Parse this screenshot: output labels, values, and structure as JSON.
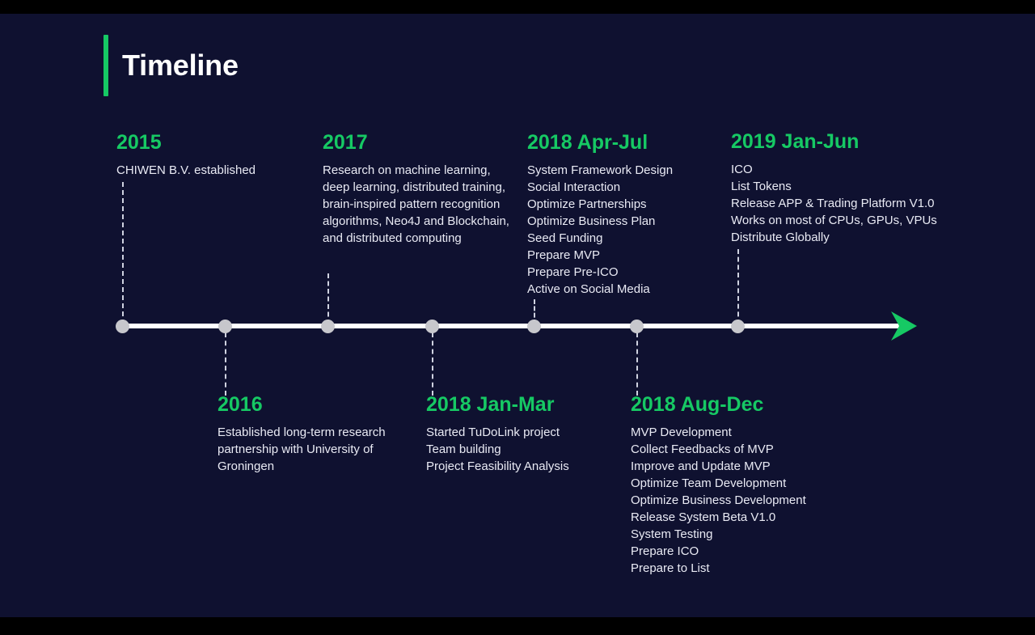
{
  "slide": {
    "title": "Timeline",
    "background_color": "#0f1130",
    "letterbox_color": "#000000",
    "accent_color": "#16c964",
    "text_color": "#e9eaf4",
    "axis_color": "#ffffff",
    "dot_color": "#c7c7cc"
  },
  "axis": {
    "arrow_icon": "arrow-right-icon",
    "node_count": 7
  },
  "entries": [
    {
      "id": "2015",
      "year": "2015",
      "position": "above",
      "lines": [
        "CHIWEN B.V. established"
      ]
    },
    {
      "id": "2016",
      "year": "2016",
      "position": "below",
      "lines": [
        "Established long-term research partnership with University of Groningen"
      ]
    },
    {
      "id": "2017",
      "year": "2017",
      "position": "above",
      "lines": [
        "Research on machine learning, deep learning, distributed training, brain-inspired pattern recognition algorithms, Neo4J and Blockchain, and distributed computing"
      ]
    },
    {
      "id": "2018-jan-mar",
      "year": "2018 Jan-Mar",
      "position": "below",
      "lines": [
        "Started TuDoLink project",
        "Team building",
        "Project Feasibility Analysis"
      ]
    },
    {
      "id": "2018-apr-jul",
      "year": "2018 Apr-Jul",
      "position": "above",
      "lines": [
        "System Framework Design",
        "Social Interaction",
        "Optimize Partnerships",
        "Optimize Business Plan",
        "Seed Funding",
        "Prepare MVP",
        "Prepare Pre-ICO",
        "Active on Social Media"
      ]
    },
    {
      "id": "2018-aug-dec",
      "year": "2018 Aug-Dec",
      "position": "below",
      "lines": [
        "MVP Development",
        "Collect Feedbacks of MVP",
        "Improve and Update MVP",
        "Optimize Team Development",
        "Optimize Business Development",
        "Release System Beta V1.0",
        "System Testing",
        "Prepare ICO",
        "Prepare to List"
      ]
    },
    {
      "id": "2019-jan-jun",
      "year": "2019 Jan-Jun",
      "position": "above",
      "lines": [
        "ICO",
        "List Tokens",
        "Release APP & Trading Platform V1.0",
        "Works on most of CPUs, GPUs, VPUs",
        "Distribute Globally"
      ]
    }
  ]
}
